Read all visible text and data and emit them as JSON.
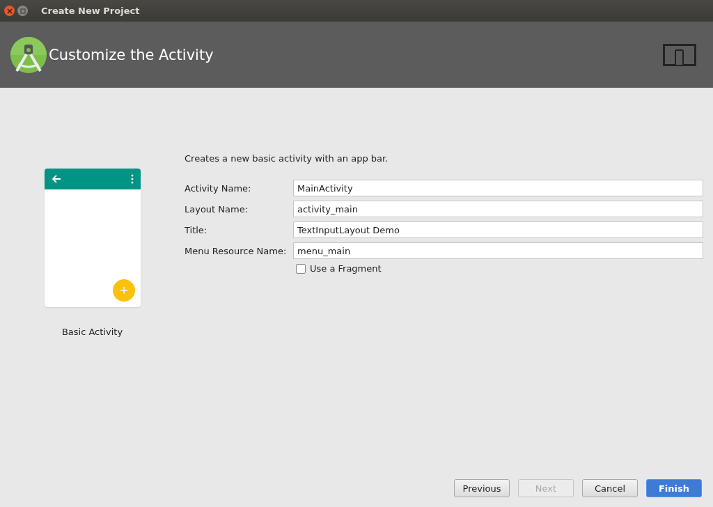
{
  "window": {
    "title": "Create New Project"
  },
  "header": {
    "title": "Customize the Activity"
  },
  "template": {
    "name": "Basic Activity"
  },
  "description": "Creates a new basic activity with an app bar.",
  "fields": [
    {
      "label": "Activity Name:",
      "value": "MainActivity"
    },
    {
      "label": "Layout Name:",
      "value": "activity_main"
    },
    {
      "label": "Title:",
      "value": "TextInputLayout Demo"
    },
    {
      "label": "Menu Resource Name:",
      "value": "menu_main"
    }
  ],
  "fragment_option": {
    "label": "Use a Fragment",
    "checked": false
  },
  "buttons": [
    {
      "label": "Previous",
      "disabled": false,
      "primary": false
    },
    {
      "label": "Next",
      "disabled": true,
      "primary": false
    },
    {
      "label": "Cancel",
      "disabled": false,
      "primary": false
    },
    {
      "label": "Finish",
      "disabled": false,
      "primary": true
    }
  ]
}
